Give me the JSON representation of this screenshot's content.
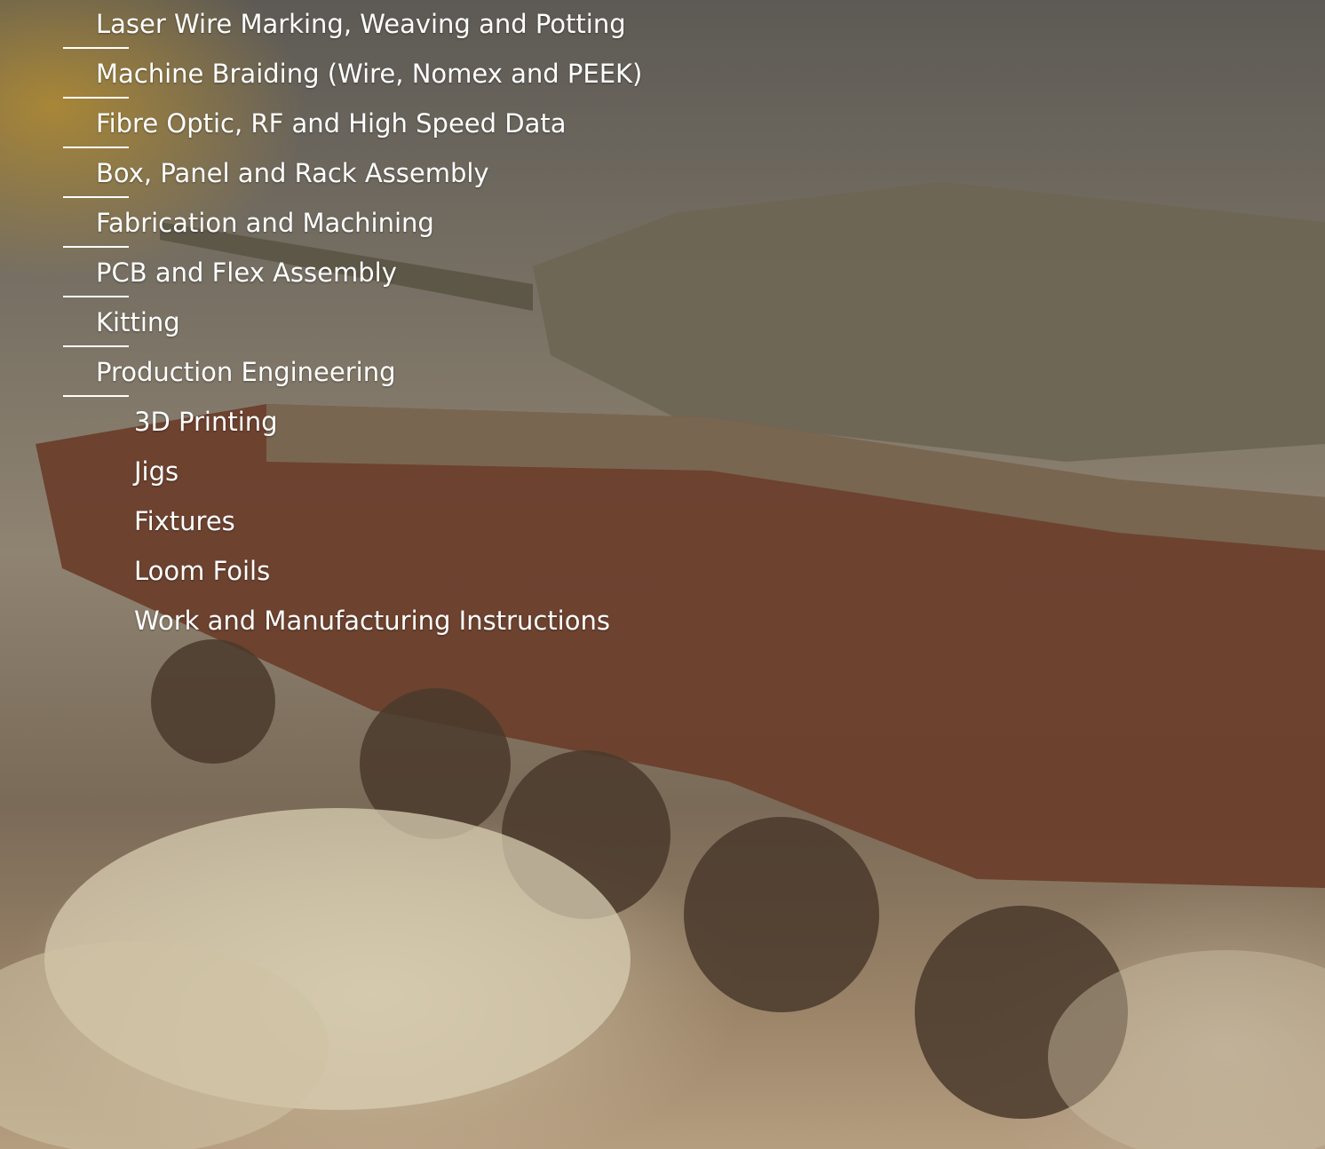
{
  "services": [
    {
      "label": "Laser Wire Marking, Weaving and Potting",
      "level": 1
    },
    {
      "label": "Machine Braiding (Wire, Nomex and PEEK)",
      "level": 1
    },
    {
      "label": "Fibre Optic, RF and High Speed Data",
      "level": 1
    },
    {
      "label": "Box, Panel and Rack Assembly",
      "level": 1
    },
    {
      "label": "Fabrication and Machining",
      "level": 1
    },
    {
      "label": "PCB and Flex Assembly",
      "level": 1
    },
    {
      "label": "Kitting",
      "level": 1
    },
    {
      "label": "Production Engineering",
      "level": 1
    },
    {
      "label": "3D Printing",
      "level": 2
    },
    {
      "label": "Jigs",
      "level": 2
    },
    {
      "label": "Fixtures",
      "level": 2
    },
    {
      "label": "Loom Foils",
      "level": 2
    },
    {
      "label": "Work and Manufacturing Instructions",
      "level": 2
    }
  ],
  "colors": {
    "text": "#ffffff",
    "divider": "#ffffff",
    "tank_body": "#6e5e49",
    "tank_hull": "#6b3f2c",
    "dust": "#d8cdb3"
  },
  "background": {
    "subject": "tank-photo"
  }
}
